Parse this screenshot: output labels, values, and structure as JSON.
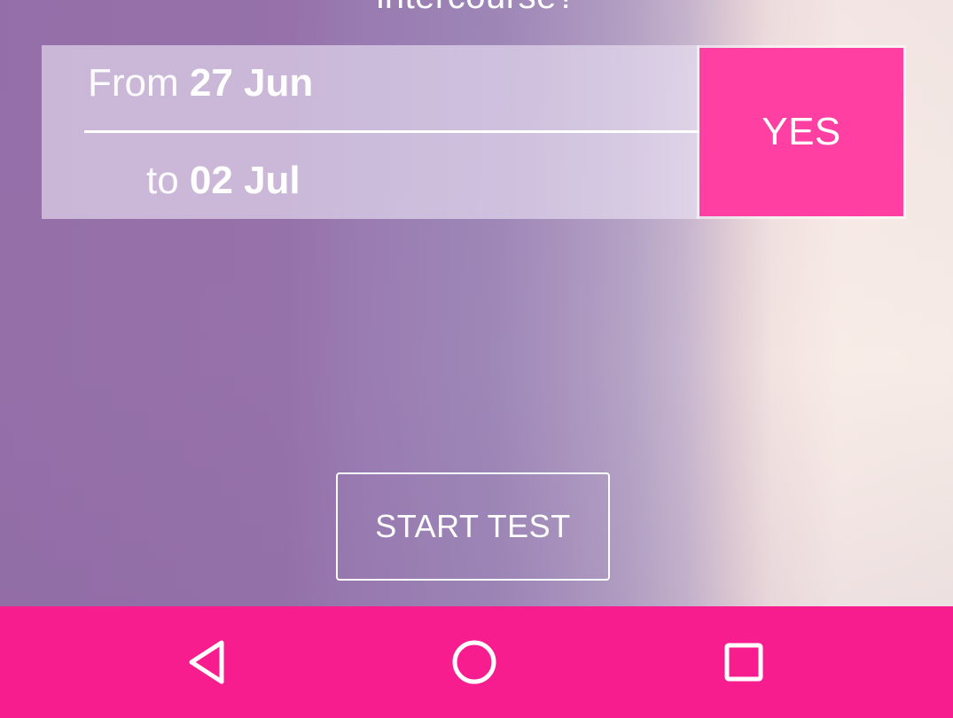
{
  "header": {
    "cut_off_text": "intercourse?"
  },
  "date_range": {
    "from_label": "From",
    "from_value": "27 Jun",
    "to_label": "to",
    "to_value": "02 Jul"
  },
  "answer": {
    "yes_label": "YES"
  },
  "actions": {
    "start_test_label": "START TEST"
  },
  "navigation": {
    "back_icon": "back-triangle-icon",
    "home_icon": "home-circle-icon",
    "recent_icon": "recent-apps-square-icon"
  },
  "colors": {
    "accent": "#ff3fa1",
    "nav_bar": "#f81d8f"
  }
}
